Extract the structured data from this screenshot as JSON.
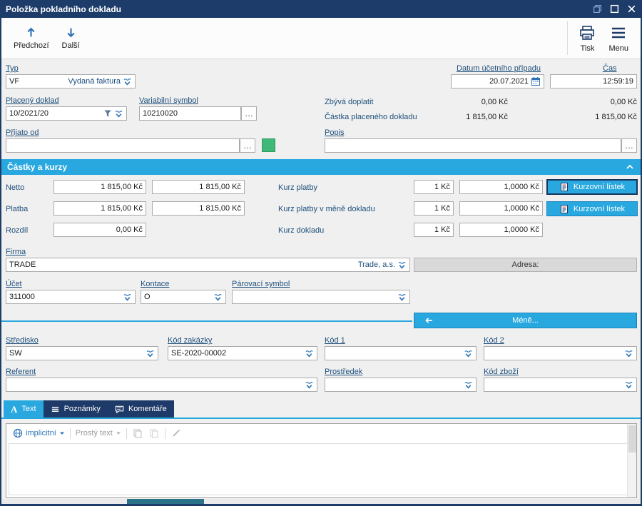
{
  "window": {
    "title": "Položka pokladního dokladu"
  },
  "toolbar": {
    "previous": "Předchozí",
    "next": "Další",
    "print": "Tisk",
    "menu": "Menu"
  },
  "header_fields": {
    "typ": {
      "label": "Typ",
      "code": "VF",
      "value": "Vydaná faktura"
    },
    "datum": {
      "label": "Datum účetního případu",
      "value": "20.07.2021"
    },
    "cas": {
      "label": "Čas",
      "value": "12:59:19"
    },
    "placeny_doklad": {
      "label": "Placený doklad",
      "value": "10/2021/20"
    },
    "variabilni_symbol": {
      "label": "Variabilní symbol",
      "value": "10210020"
    },
    "zbyva_doplatit": {
      "label": "Zbývá doplatit",
      "value_czk": "0,00 Kč",
      "value_doc": "0,00 Kč"
    },
    "castka_placeneho_dokladu": {
      "label": "Částka placeného dokladu",
      "value_czk": "1 815,00 Kč",
      "value_doc": "1 815,00 Kč"
    },
    "prijato_od": {
      "label": "Přijato od",
      "value": ""
    },
    "popis": {
      "label": "Popis",
      "value": ""
    }
  },
  "amounts": {
    "title": "Částky a kurzy",
    "netto": {
      "label": "Netto",
      "v1": "1 815,00 Kč",
      "v2": "1 815,00 Kč"
    },
    "platba": {
      "label": "Platba",
      "v1": "1 815,00 Kč",
      "v2": "1 815,00 Kč"
    },
    "rozdil": {
      "label": "Rozdíl",
      "v1": "0,00 Kč"
    },
    "kurz_platby": {
      "label": "Kurz platby",
      "v1": "1 Kč",
      "v2": "1,0000 Kč"
    },
    "kurz_platby_mena": {
      "label": "Kurz platby v měně dokladu",
      "v1": "1 Kč",
      "v2": "1,0000 Kč"
    },
    "kurz_dokladu": {
      "label": "Kurz dokladu",
      "v1": "1 Kč",
      "v2": "1,0000 Kč"
    },
    "rate_button": "Kurzovní lístek"
  },
  "company": {
    "firma": {
      "label": "Firma",
      "code": "TRADE",
      "name": "Trade, a.s."
    },
    "adresa_label": "Adresa:",
    "ucet": {
      "label": "Účet",
      "value": "311000"
    },
    "kontace": {
      "label": "Kontace",
      "value": "O"
    },
    "parovaci_symbol": {
      "label": "Párovací symbol",
      "value": ""
    },
    "less_button": "Méně..."
  },
  "codes": {
    "stredisko": {
      "label": "Středisko",
      "value": "SW"
    },
    "kod_zakazky": {
      "label": "Kód zakázky",
      "value": "SE-2020-00002"
    },
    "kod_1": {
      "label": "Kód 1",
      "value": ""
    },
    "kod_2": {
      "label": "Kód 2",
      "value": ""
    },
    "referent": {
      "label": "Referent",
      "value": ""
    },
    "prostredek": {
      "label": "Prostředek",
      "value": ""
    },
    "kod_zbozi": {
      "label": "Kód zboží",
      "value": ""
    }
  },
  "tabs": {
    "text": "Text",
    "poznamky": "Poznámky",
    "komentare": "Komentáře"
  },
  "editor": {
    "language": "implicitní",
    "format": "Prostý text",
    "content": ""
  },
  "icons": {
    "ellipsis": "…",
    "text_tab_icon": "A"
  },
  "colors": {
    "accent": "#29a8e0",
    "titlebar": "#1d3c69",
    "label_blue": "#1d4f7c",
    "green_button": "#3fb878",
    "scrollbar_teal": "#2a7287"
  }
}
